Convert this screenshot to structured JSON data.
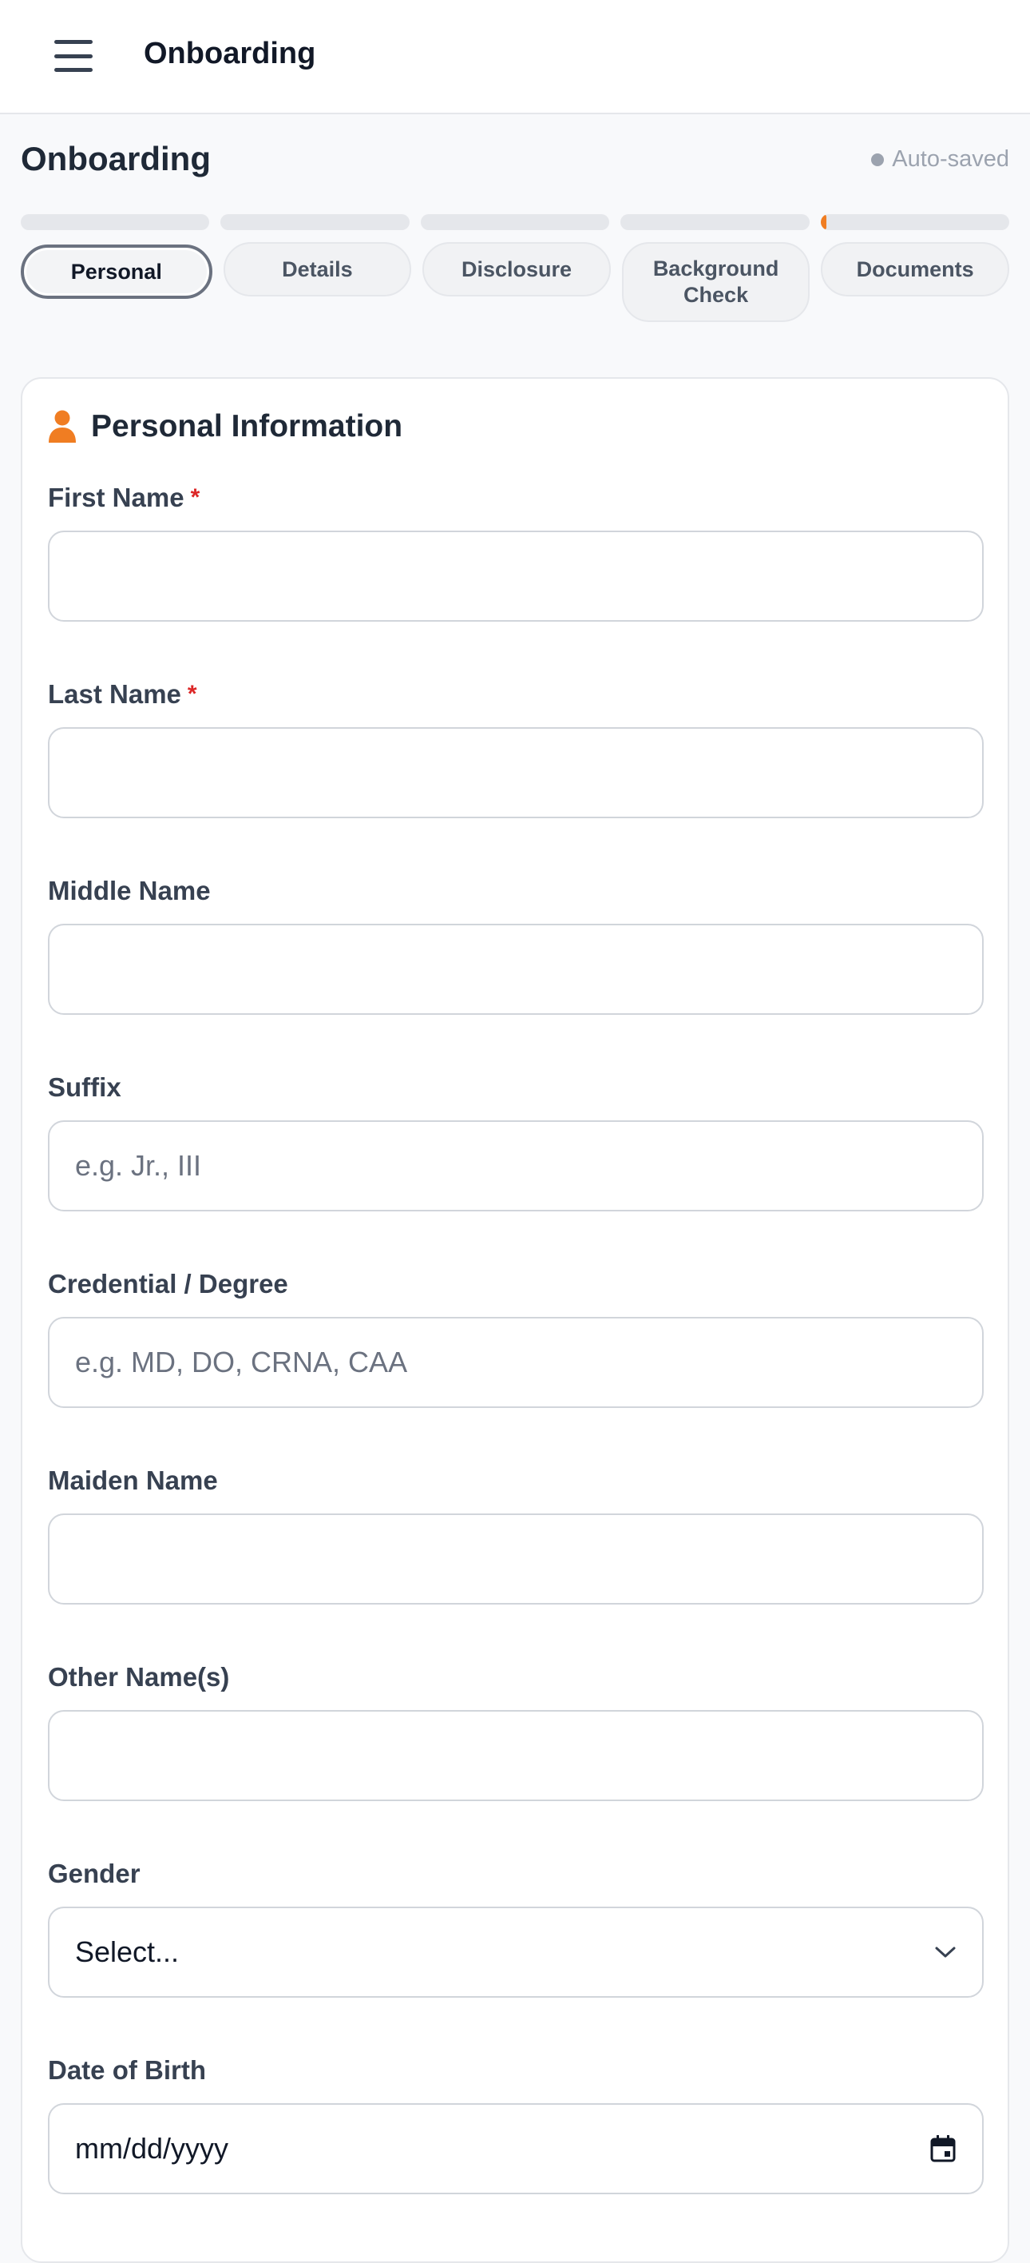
{
  "topbar": {
    "title": "Onboarding"
  },
  "page": {
    "title": "Onboarding",
    "autosave": "Auto-saved"
  },
  "progress": {
    "segments": [
      0,
      0,
      0,
      0,
      0.03
    ],
    "accent": "#f07d22"
  },
  "steps": [
    {
      "label": "Personal"
    },
    {
      "label": "Details"
    },
    {
      "label": "Disclosure"
    },
    {
      "label": "Background Check"
    },
    {
      "label": "Documents"
    }
  ],
  "section": {
    "title": "Personal Information",
    "icon": "person-icon"
  },
  "fields": {
    "first_name": {
      "label": "First Name",
      "required_mark": "*",
      "value": "",
      "placeholder": ""
    },
    "last_name": {
      "label": "Last Name",
      "required_mark": "*",
      "value": "",
      "placeholder": ""
    },
    "middle_name": {
      "label": "Middle Name",
      "value": "",
      "placeholder": ""
    },
    "suffix": {
      "label": "Suffix",
      "value": "",
      "placeholder": "e.g. Jr., III"
    },
    "credential": {
      "label": "Credential / Degree",
      "value": "",
      "placeholder": "e.g. MD, DO, CRNA, CAA"
    },
    "maiden_name": {
      "label": "Maiden Name",
      "value": "",
      "placeholder": ""
    },
    "other_names": {
      "label": "Other Name(s)",
      "value": "",
      "placeholder": ""
    },
    "gender": {
      "label": "Gender",
      "selected": "Select..."
    },
    "dob": {
      "label": "Date of Birth",
      "value": "mm/dd/yyyy"
    }
  }
}
